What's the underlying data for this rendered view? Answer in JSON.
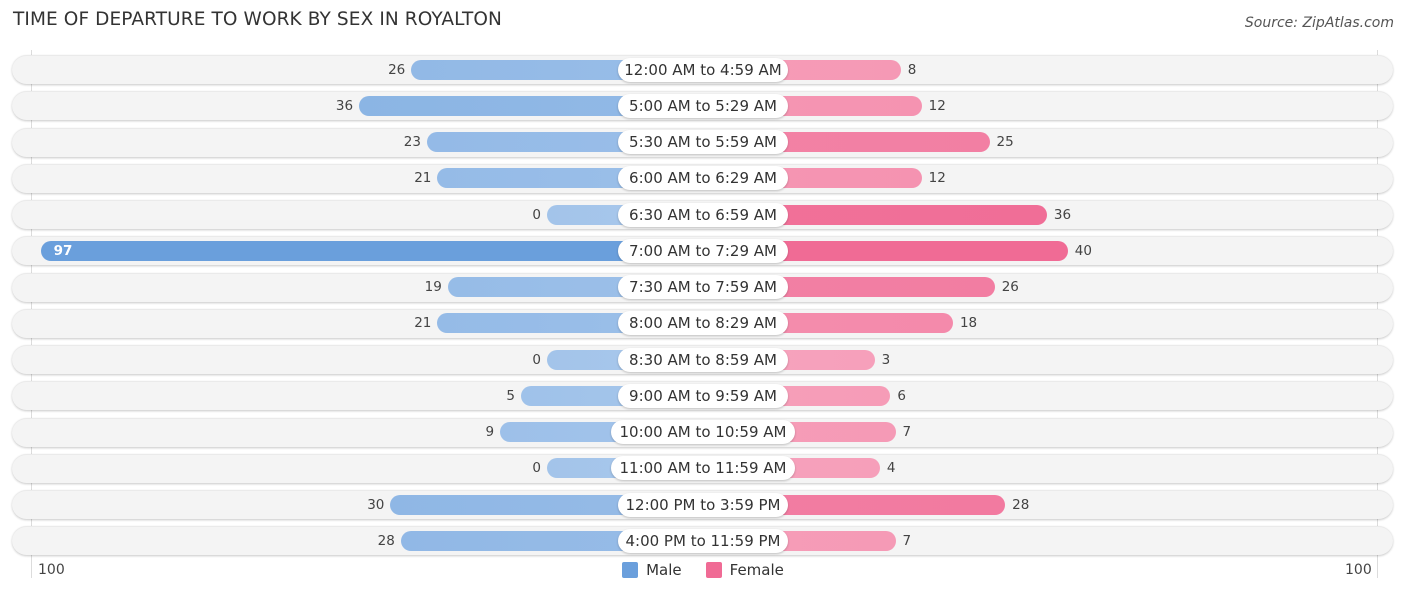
{
  "header": {
    "title": "TIME OF DEPARTURE TO WORK BY SEX IN ROYALTON",
    "source": "Source: ZipAtlas.com"
  },
  "colors": {
    "male": "#6a9fdc",
    "male_light": "#a9c8ec",
    "female": "#f06b95",
    "female_light": "#f7a8c0"
  },
  "chart_data": {
    "type": "bar",
    "orientation": "horizontal-diverging",
    "title": "TIME OF DEPARTURE TO WORK BY SEX IN ROYALTON",
    "categories": [
      "12:00 AM to 4:59 AM",
      "5:00 AM to 5:29 AM",
      "5:30 AM to 5:59 AM",
      "6:00 AM to 6:29 AM",
      "6:30 AM to 6:59 AM",
      "7:00 AM to 7:29 AM",
      "7:30 AM to 7:59 AM",
      "8:00 AM to 8:29 AM",
      "8:30 AM to 8:59 AM",
      "9:00 AM to 9:59 AM",
      "10:00 AM to 10:59 AM",
      "11:00 AM to 11:59 AM",
      "12:00 PM to 3:59 PM",
      "4:00 PM to 11:59 PM"
    ],
    "series": [
      {
        "name": "Male",
        "values": [
          26,
          36,
          23,
          21,
          0,
          97,
          19,
          21,
          0,
          5,
          9,
          0,
          30,
          28
        ]
      },
      {
        "name": "Female",
        "values": [
          8,
          12,
          25,
          12,
          36,
          40,
          26,
          18,
          3,
          6,
          7,
          4,
          28,
          7
        ]
      }
    ],
    "axis": {
      "left_label": "100",
      "right_label": "100",
      "range": [
        0,
        100
      ]
    },
    "legend": {
      "position": "bottom-center",
      "entries": [
        "Male",
        "Female"
      ]
    },
    "grid": false
  }
}
